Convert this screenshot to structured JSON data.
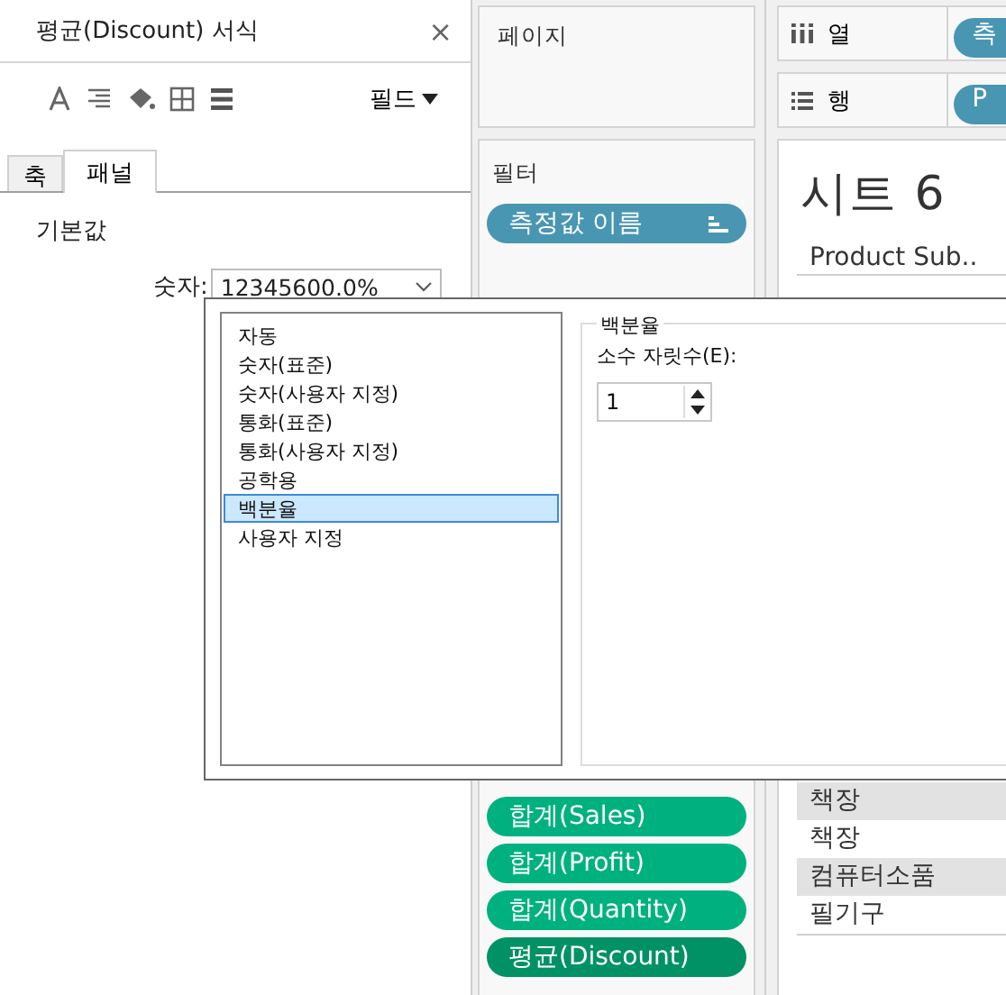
{
  "format_panel": {
    "title": "평균(Discount) 서식",
    "close": "×",
    "menu": "필드",
    "tabs": [
      {
        "label": "축",
        "selected": false
      },
      {
        "label": "패널",
        "selected": true
      }
    ],
    "section": "기본값",
    "number_field": {
      "label": "숫자:",
      "value": "12345600.0%"
    }
  },
  "pages": {
    "title": "페이지"
  },
  "filters": {
    "title": "필터",
    "pills": [
      {
        "label": "측정값 이름"
      }
    ]
  },
  "marks_pills": [
    {
      "label": "합계(Sales)",
      "selected": false
    },
    {
      "label": "합계(Profit)",
      "selected": false
    },
    {
      "label": "합계(Quantity)",
      "selected": false
    },
    {
      "label": "평균(Discount)",
      "selected": true
    }
  ],
  "columns_shelf": {
    "title": "열",
    "pill": "측"
  },
  "rows_shelf": {
    "title": "행",
    "pill": "P"
  },
  "sheet": {
    "title": "시트 6",
    "column_header": "Product Sub..",
    "rows": [
      {
        "label": "책장",
        "shaded": true
      },
      {
        "label": "책장",
        "shaded": false
      },
      {
        "label": "컴퓨터소품",
        "shaded": true
      },
      {
        "label": "필기구",
        "shaded": false
      }
    ]
  },
  "format_popup": {
    "types": [
      {
        "label": "자동",
        "selected": false
      },
      {
        "label": "숫자(표준)",
        "selected": false
      },
      {
        "label": "숫자(사용자 지정)",
        "selected": false
      },
      {
        "label": "통화(표준)",
        "selected": false
      },
      {
        "label": "통화(사용자 지정)",
        "selected": false
      },
      {
        "label": "공학용",
        "selected": false
      },
      {
        "label": "백분율",
        "selected": true
      },
      {
        "label": "사용자 지정",
        "selected": false
      }
    ],
    "group_title": "백분율",
    "decimals_label": "소수 자릿수(E):",
    "decimals_value": "1"
  }
}
